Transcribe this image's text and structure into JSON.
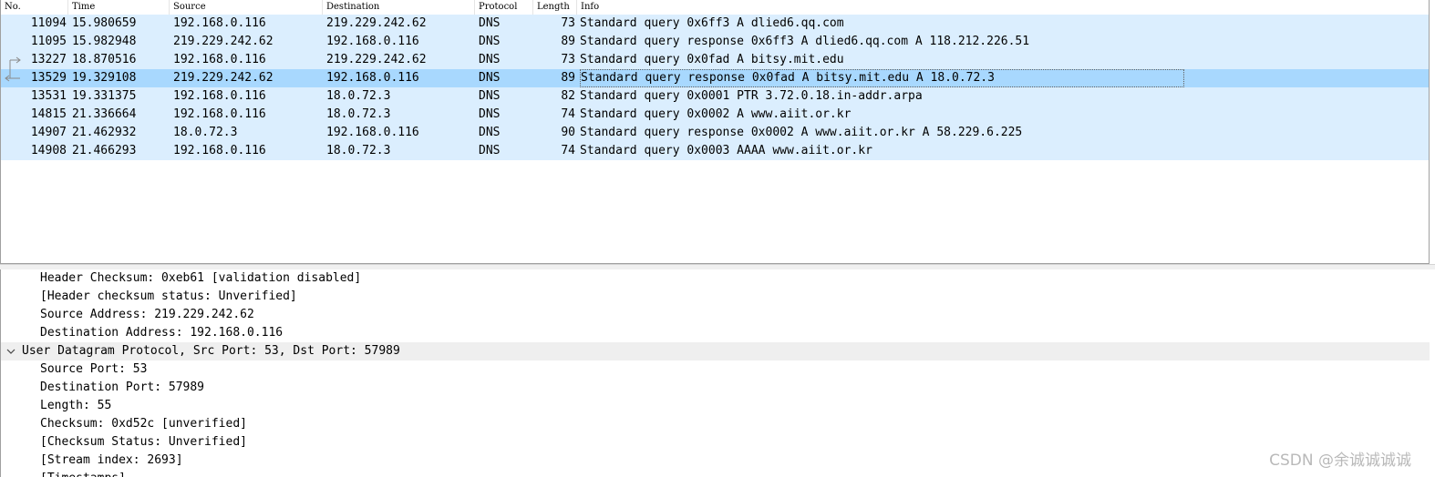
{
  "columns": {
    "no": "No.",
    "time": "Time",
    "source": "Source",
    "destination": "Destination",
    "protocol": "Protocol",
    "length": "Length",
    "info": "Info"
  },
  "packets": [
    {
      "no": "11094",
      "time": "15.980659",
      "source": "192.168.0.116",
      "destination": "219.229.242.62",
      "protocol": "DNS",
      "length": "73",
      "info": "Standard query 0x6ff3 A dlied6.qq.com"
    },
    {
      "no": "11095",
      "time": "15.982948",
      "source": "219.229.242.62",
      "destination": "192.168.0.116",
      "protocol": "DNS",
      "length": "89",
      "info": "Standard query response 0x6ff3 A dlied6.qq.com A 118.212.226.51"
    },
    {
      "no": "13227",
      "time": "18.870516",
      "source": "192.168.0.116",
      "destination": "219.229.242.62",
      "protocol": "DNS",
      "length": "73",
      "info": "Standard query 0x0fad A bitsy.mit.edu"
    },
    {
      "no": "13529",
      "time": "19.329108",
      "source": "219.229.242.62",
      "destination": "192.168.0.116",
      "protocol": "DNS",
      "length": "89",
      "info": "Standard query response 0x0fad A bitsy.mit.edu A 18.0.72.3"
    },
    {
      "no": "13531",
      "time": "19.331375",
      "source": "192.168.0.116",
      "destination": "18.0.72.3",
      "protocol": "DNS",
      "length": "82",
      "info": "Standard query 0x0001 PTR 3.72.0.18.in-addr.arpa"
    },
    {
      "no": "14815",
      "time": "21.336664",
      "source": "192.168.0.116",
      "destination": "18.0.72.3",
      "protocol": "DNS",
      "length": "74",
      "info": "Standard query 0x0002 A www.aiit.or.kr"
    },
    {
      "no": "14907",
      "time": "21.462932",
      "source": "18.0.72.3",
      "destination": "192.168.0.116",
      "protocol": "DNS",
      "length": "90",
      "info": "Standard query response 0x0002 A www.aiit.or.kr A 58.229.6.225"
    },
    {
      "no": "14908",
      "time": "21.466293",
      "source": "192.168.0.116",
      "destination": "18.0.72.3",
      "protocol": "DNS",
      "length": "74",
      "info": "Standard query 0x0003 AAAA www.aiit.or.kr"
    }
  ],
  "selected_packet": "13529",
  "details": {
    "lines": [
      "Header Checksum: 0xeb61 [validation disabled]",
      "[Header checksum status: Unverified]",
      "Source Address: 219.229.242.62",
      "Destination Address: 192.168.0.116"
    ],
    "udp_section": "User Datagram Protocol, Src Port: 53, Dst Port: 57989",
    "udp_lines": [
      "Source Port: 53",
      "Destination Port: 57989",
      "Length: 55",
      "Checksum: 0xd52c [unverified]",
      "[Checksum Status: Unverified]",
      "[Stream index: 2693]",
      "[Timestamps]"
    ]
  },
  "watermark": "CSDN @余诚诚诚诚",
  "colors": {
    "row_bg": "#dbeefe",
    "selected_bg": "#a8d8fe",
    "section_bg": "#efefef"
  },
  "icons": {
    "request_marker": "conversation-request-arrow-icon",
    "response_marker": "conversation-response-arrow-icon",
    "expand": "chevron-down-icon"
  }
}
